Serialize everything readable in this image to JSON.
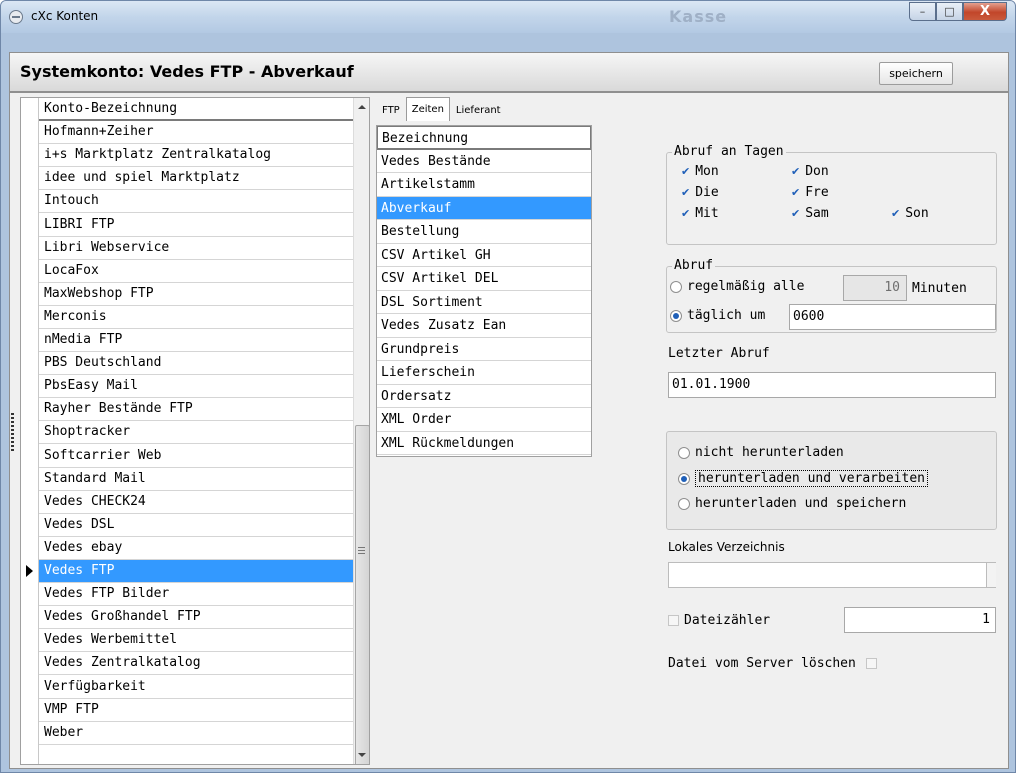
{
  "window": {
    "title": "cXc Konten",
    "ghost_title": "Kasse",
    "buttons": {
      "minimize": "–",
      "maximize": "□",
      "close": "X"
    }
  },
  "header": {
    "title": "Systemkonto: Vedes FTP - Abverkauf",
    "save_label": "speichern"
  },
  "accounts": {
    "column_header": "Konto-Bezeichnung",
    "items": [
      "Hofmann+Zeiher",
      "i+s Marktplatz Zentralkatalog",
      "idee und spiel Marktplatz",
      "Intouch",
      "LIBRI FTP",
      "Libri Webservice",
      "LocaFox",
      "MaxWebshop FTP",
      "Merconis",
      "nMedia FTP",
      "PBS Deutschland",
      "PbsEasy Mail",
      "Rayher Bestände FTP",
      "Shoptracker",
      "Softcarrier Web",
      "Standard Mail",
      "Vedes CHECK24",
      "Vedes DSL",
      "Vedes ebay",
      "Vedes FTP",
      "Vedes FTP Bilder",
      "Vedes Großhandel FTP",
      "Vedes Werbemittel",
      "Vedes Zentralkatalog",
      "Verfügbarkeit",
      "VMP FTP",
      "Weber"
    ],
    "selected": "Vedes FTP"
  },
  "tabs": [
    "FTP",
    "Zeiten",
    "Lieferant"
  ],
  "active_tab": "Zeiten",
  "entries": {
    "column_header": "Bezeichnung",
    "items": [
      "Vedes Bestände",
      "Artikelstamm",
      "Abverkauf",
      "Bestellung",
      "CSV Artikel GH",
      "CSV Artikel DEL",
      "DSL Sortiment",
      "Vedes Zusatz Ean",
      "Grundpreis",
      "Lieferschein",
      "Ordersatz",
      "XML Order",
      "XML Rückmeldungen"
    ],
    "selected": "Abverkauf"
  },
  "days_group": {
    "label": "Abruf an Tagen",
    "check_glyph": "✔",
    "days": [
      "Mon",
      "Don",
      "Die",
      "Fre",
      "Mit",
      "Sam",
      "Son"
    ],
    "checked": [
      true,
      true,
      true,
      true,
      true,
      true,
      true
    ]
  },
  "abruf_group": {
    "label": "Abruf",
    "regular_label": "regelmäßig alle",
    "interval_value": "10",
    "interval_unit": "Minuten",
    "daily_label": "täglich um",
    "daily_time": "0600",
    "selected_mode": "daily"
  },
  "last_fetch": {
    "label": "Letzter Abruf",
    "value": "01.01.1900"
  },
  "download_options": {
    "options": [
      "nicht herunterladen",
      "herunterladen und verarbeiten",
      "herunterladen und speichern"
    ],
    "selected_index": 1
  },
  "local_dir": {
    "label": "Lokales Verzeichnis",
    "value": ""
  },
  "file_counter": {
    "label": "Dateizähler",
    "checked": false,
    "value": "1"
  },
  "delete_from_server": {
    "label": "Datei vom Server löschen",
    "checked": false
  },
  "colors": {
    "selection": "#3399ff",
    "panel_bg": "#f0f0f0",
    "titlebar": "#c2d5ea",
    "check_blue": "#1f5fb8"
  }
}
